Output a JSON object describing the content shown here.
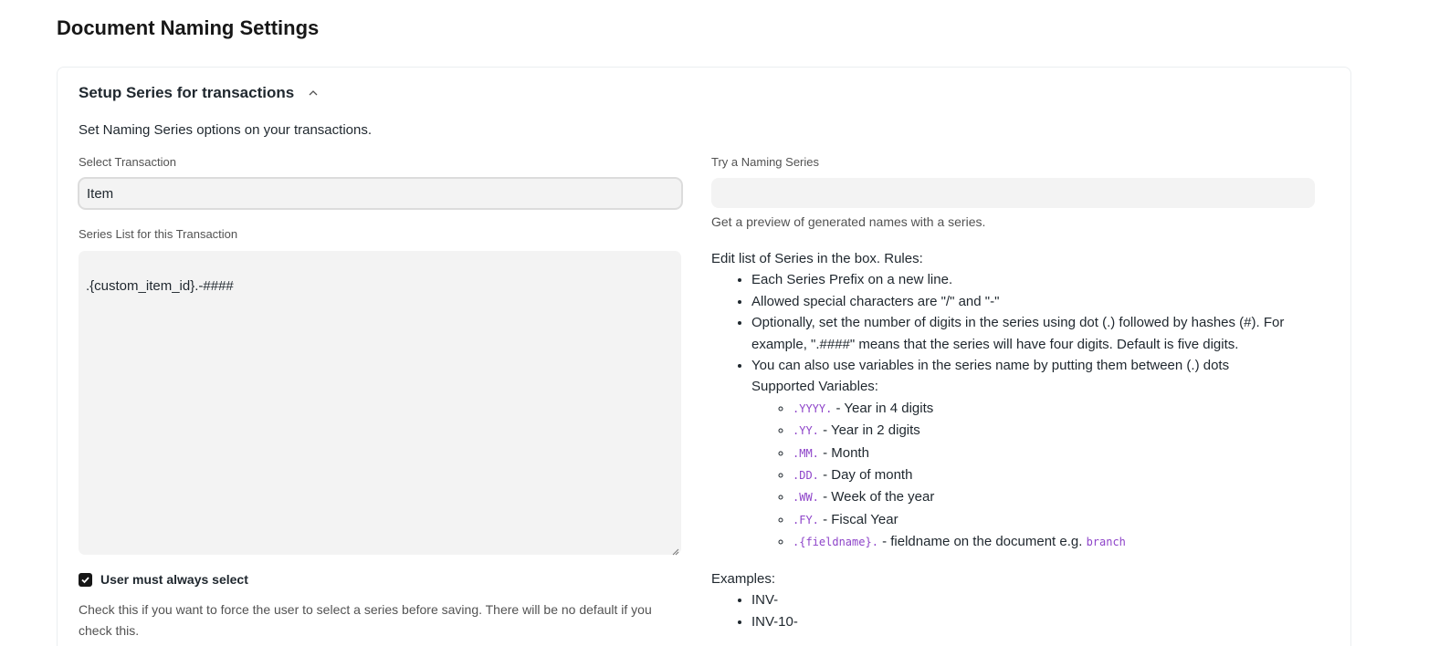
{
  "page": {
    "title": "Document Naming Settings"
  },
  "section": {
    "title": "Setup Series for transactions",
    "description": "Set Naming Series options on your transactions."
  },
  "left": {
    "select_label": "Select Transaction",
    "select_value": "Item",
    "series_label": "Series List for this Transaction",
    "series_value": ".{custom_item_id}.-####",
    "checkbox_label": "User must always select",
    "checkbox_checked": true,
    "checkbox_help": "Check this if you want to force the user to select a series before saving. There will be no default if you check this."
  },
  "right": {
    "try_label": "Try a Naming Series",
    "try_value": "",
    "try_help": "Get a preview of generated names with a series.",
    "rules_title": "Edit list of Series in the box. Rules:",
    "rules": [
      "Each Series Prefix on a new line.",
      "Allowed special characters are \"/\" and \"-\"",
      "Optionally, set the number of digits in the series using dot (.) followed by hashes (#). For example, \".####\" means that the series will have four digits. Default is five digits."
    ],
    "variables_rule_line1": "You can also use variables in the series name by putting them between (.) dots",
    "variables_rule_line2": "Supported Variables:",
    "variables": [
      {
        "code": ".YYYY.",
        "desc": " - Year in 4 digits"
      },
      {
        "code": ".YY.",
        "desc": " - Year in 2 digits"
      },
      {
        "code": ".MM.",
        "desc": " - Month"
      },
      {
        "code": ".DD.",
        "desc": " - Day of month"
      },
      {
        "code": ".WW.",
        "desc": " - Week of the year"
      },
      {
        "code": ".FY.",
        "desc": " - Fiscal Year"
      },
      {
        "code": ".{fieldname}.",
        "desc": " - fieldname on the document e.g. ",
        "extra_code": "branch"
      }
    ],
    "examples_title": "Examples:",
    "examples": [
      "INV-",
      "INV-10-"
    ]
  },
  "colors": {
    "code": "#8e44c9",
    "input_bg": "#f3f3f3",
    "checkbox": "#171717"
  },
  "icons": {
    "collapse": "chevron-up-icon",
    "check": "check-icon",
    "resize": "resize-handle-icon"
  }
}
